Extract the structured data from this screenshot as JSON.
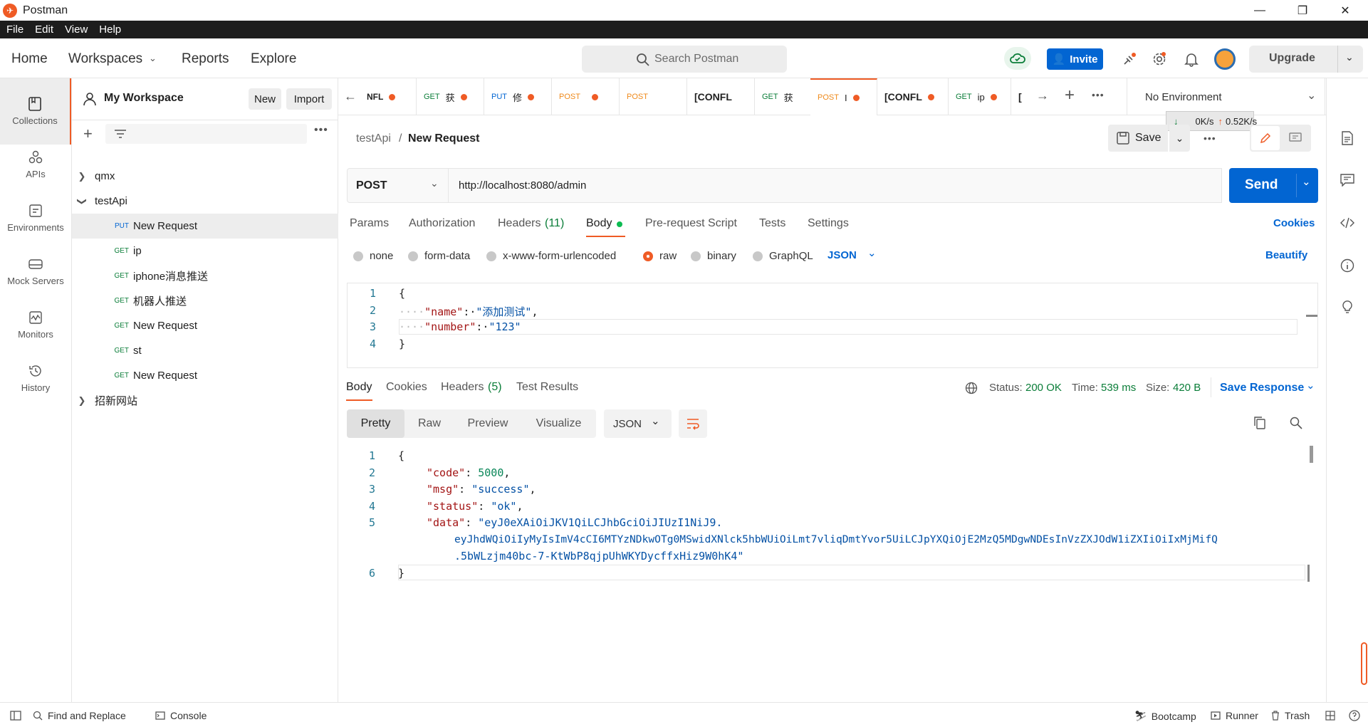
{
  "window": {
    "title": "Postman"
  },
  "menu": [
    "File",
    "Edit",
    "View",
    "Help"
  ],
  "header": {
    "nav": [
      "Home",
      "Workspaces",
      "Reports",
      "Explore"
    ],
    "search_placeholder": "Search Postman",
    "invite": "Invite",
    "upgrade": "Upgrade"
  },
  "rail": [
    {
      "label": "Collections",
      "icon": "collections-icon"
    },
    {
      "label": "APIs",
      "icon": "apis-icon"
    },
    {
      "label": "Environments",
      "icon": "environments-icon"
    },
    {
      "label": "Mock Servers",
      "icon": "mock-servers-icon"
    },
    {
      "label": "Monitors",
      "icon": "monitors-icon"
    },
    {
      "label": "History",
      "icon": "history-icon"
    }
  ],
  "sidebar": {
    "workspace": "My Workspace",
    "new": "New",
    "import": "Import",
    "tree": [
      {
        "label": "qmx",
        "type": "folder",
        "expanded": false
      },
      {
        "label": "testApi",
        "type": "folder",
        "expanded": true
      },
      {
        "label": "New Request",
        "method": "PUT",
        "selected": true
      },
      {
        "label": "ip",
        "method": "GET"
      },
      {
        "label": "iphone消息推送",
        "method": "GET"
      },
      {
        "label": "机器人推送",
        "method": "GET"
      },
      {
        "label": "New Request",
        "method": "GET"
      },
      {
        "label": "st",
        "method": "GET"
      },
      {
        "label": "New Request",
        "method": "GET"
      },
      {
        "label": "招新网站",
        "type": "folder",
        "expanded": false
      }
    ]
  },
  "tabs": [
    {
      "method": "",
      "label": "NFL",
      "dot": true
    },
    {
      "method": "GET",
      "label": "获",
      "dot": true
    },
    {
      "method": "PUT",
      "label": "修",
      "dot": true
    },
    {
      "method": "POST",
      "label": "",
      "dot": true
    },
    {
      "method": "POST",
      "label": "",
      "dot": false
    },
    {
      "method": "",
      "label": "[CONFL",
      "dot": false
    },
    {
      "method": "GET",
      "label": "获",
      "dot": false
    },
    {
      "method": "POST",
      "label": "I",
      "dot": true,
      "active": true
    },
    {
      "method": "",
      "label": "[CONFL",
      "dot": true
    },
    {
      "method": "GET",
      "label": "ip",
      "dot": true
    },
    {
      "method": "",
      "label": "[",
      "dot": false
    }
  ],
  "environment": "No Environment",
  "network": {
    "down": "0K/s",
    "up": "0.52K/s"
  },
  "breadcrumb": {
    "collection": "testApi",
    "sep": "/",
    "request": "New Request"
  },
  "save": "Save",
  "request": {
    "method": "POST",
    "url": "http://localhost:8080/admin",
    "send": "Send",
    "tabs": [
      "Params",
      "Authorization",
      "Headers",
      "Body",
      "Pre-request Script",
      "Tests",
      "Settings"
    ],
    "headers_count": "(11)",
    "cookies": "Cookies",
    "body_types": [
      "none",
      "form-data",
      "x-www-form-urlencoded",
      "raw",
      "binary",
      "GraphQL"
    ],
    "format": "JSON",
    "beautify": "Beautify",
    "body_lines": [
      "1",
      "2",
      "3",
      "4"
    ]
  },
  "response": {
    "tabs": [
      "Body",
      "Cookies",
      "Headers",
      "Test Results"
    ],
    "headers_count": "(5)",
    "status_label": "Status:",
    "status": "200 OK",
    "time_label": "Time:",
    "time": "539 ms",
    "size_label": "Size:",
    "size": "420 B",
    "save_response": "Save Response",
    "views": [
      "Pretty",
      "Raw",
      "Preview",
      "Visualize"
    ],
    "format": "JSON",
    "lines": [
      "1",
      "2",
      "3",
      "4",
      "5",
      "",
      "",
      "6"
    ],
    "json": {
      "code": "5000",
      "msg": "\"success\"",
      "status": "\"ok\"",
      "data1": "\"eyJ0eXAiOiJKV1QiLCJhbGciOiJIUzI1NiJ9.",
      "data2": "eyJhdWQiOiIyMyIsImV4cCI6MTYzNDkwOTg0MSwidXNlck5hbWUiOiLmt7vliqDmtYvor5UiLCJpYXQiOjE2MzQ5MDgwNDEsInVzZXJOdW1iZXIiOiIxMjMifQ",
      "data3": ".5bWLzjm40bc-7-KtWbP8qjpUhWKYDycffxHiz9W0hK4\""
    }
  },
  "statusbar": {
    "find_replace": "Find and Replace",
    "console": "Console",
    "bootcamp": "Bootcamp",
    "runner": "Runner",
    "trash": "Trash"
  },
  "colors": {
    "accent": "#ef5b25",
    "primary": "#0265d2",
    "get": "#0a7d38",
    "status_ok": "#0a7d38"
  }
}
